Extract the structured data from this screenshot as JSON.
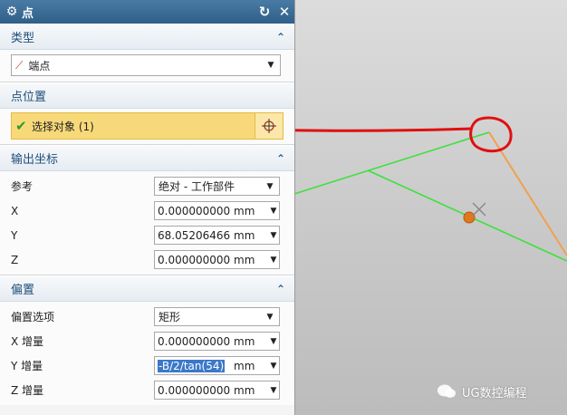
{
  "dialog": {
    "title": "点",
    "icons": {
      "gear": "gear-icon",
      "reset": "reset-icon",
      "close": "close-icon"
    }
  },
  "sections": {
    "type": {
      "header": "类型",
      "value": "端点"
    },
    "point_location": {
      "header": "点位置",
      "select_label": "选择对象 (1)"
    },
    "output_coords": {
      "header": "输出坐标",
      "reference_label": "参考",
      "reference_value": "绝对 - 工作部件",
      "x_label": "X",
      "x_value": "0.0000000000",
      "y_label": "Y",
      "y_value": "68.0520646661",
      "z_label": "Z",
      "z_value": "0.0000000000",
      "unit": "mm"
    },
    "offset": {
      "header": "偏置",
      "option_label": "偏置选项",
      "option_value": "矩形",
      "dx_label": "X 增量",
      "dx_value": "0.0000000000",
      "dy_label": "Y 增量",
      "dy_value": "-B/2/tan(54)",
      "dz_label": "Z 增量",
      "dz_value": "0.0000000000",
      "unit": "mm"
    }
  },
  "watermark": "UG数控编程",
  "colors": {
    "accent": "#2f5f88",
    "selection": "#f8d97a",
    "edge_green": "#3ee03e",
    "edge_orange": "#f0a050",
    "annotation_red": "#e01010"
  }
}
